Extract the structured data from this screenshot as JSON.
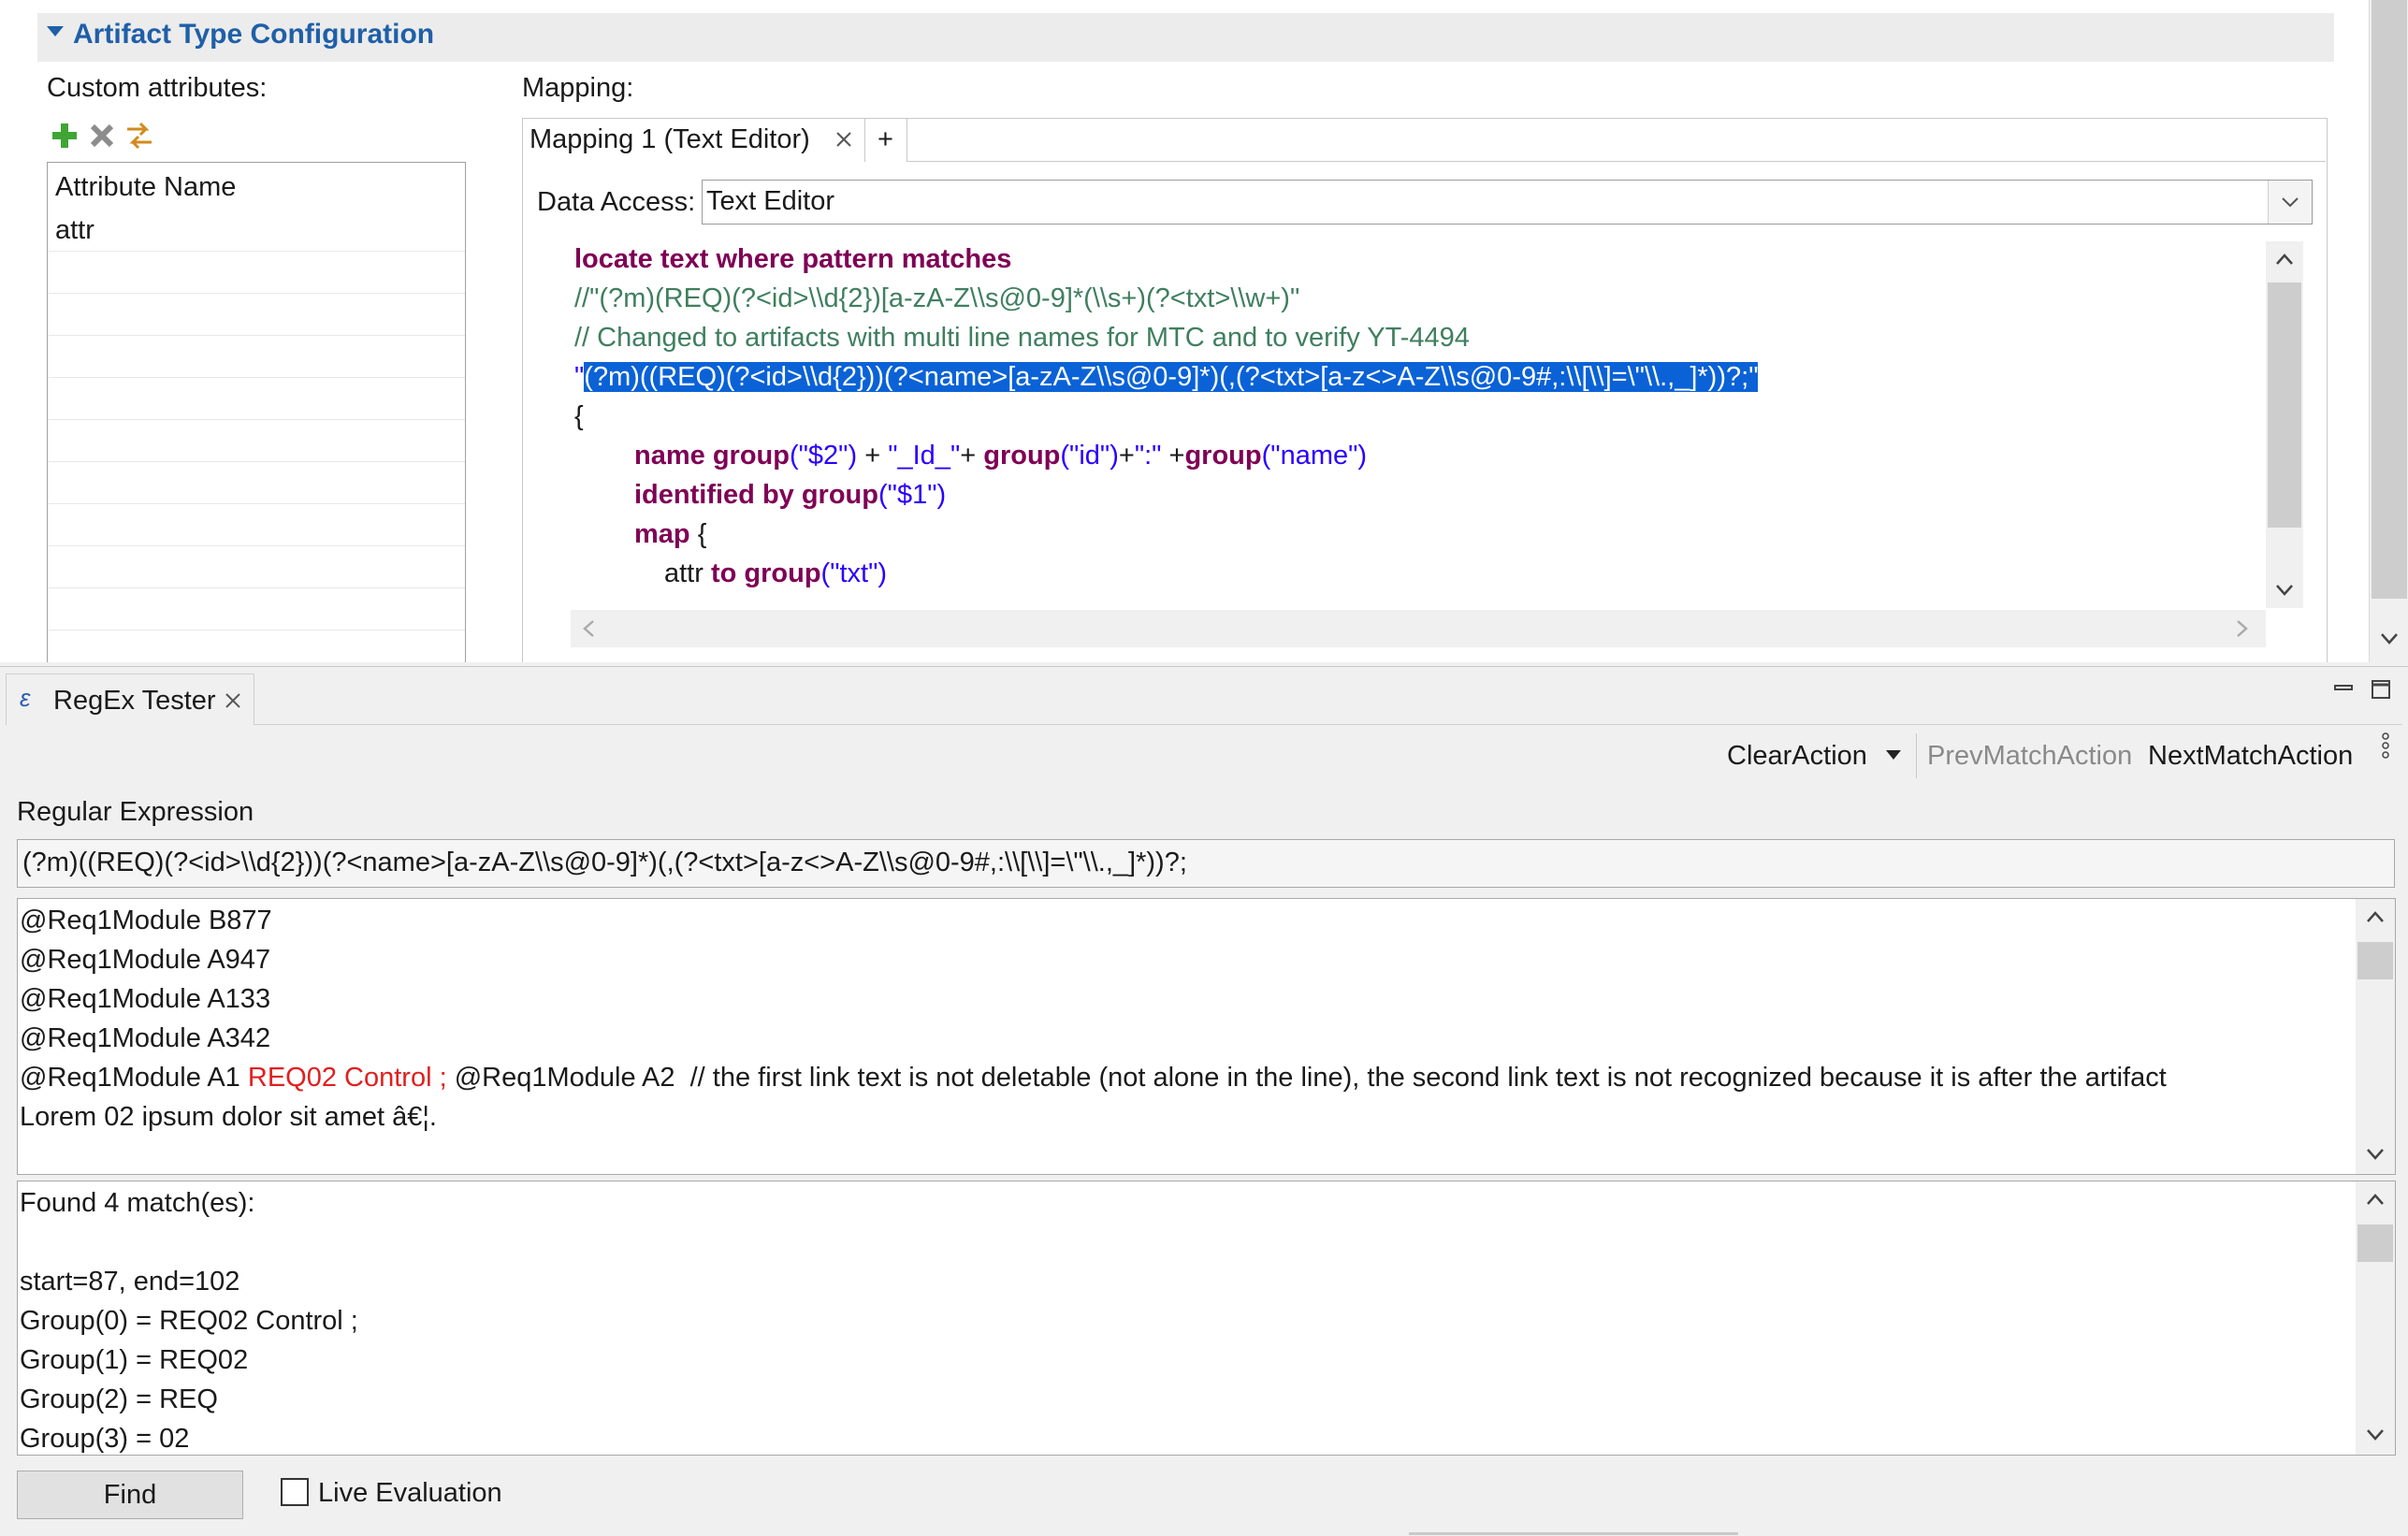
{
  "section": {
    "title": "Artifact Type Configuration"
  },
  "custom_attributes": {
    "label": "Custom attributes:",
    "table_header": "Attribute Name",
    "rows": [
      "attr"
    ]
  },
  "mapping": {
    "label": "Mapping:",
    "tab_label": "Mapping 1 (Text Editor)",
    "add_tab": "+",
    "data_access_label": "Data Access:",
    "data_access_value": "Text Editor",
    "code": {
      "l1": "locate text where pattern matches",
      "l2": "//\"(?m)(REQ)(?<id>\\\\d{2})[a-zA-Z\\\\s@0-9]*(\\\\s+)(?<txt>\\\\w+)\"",
      "l3": "// Changed to artifacts with multi line names for MTC and to verify YT-4494",
      "l4_q1": "\"",
      "l4_sel": "(?m)((REQ)(?<id>\\\\d{2}))(?<name>[a-zA-Z\\\\s@0-9]*)(,(?<txt>[a-z<>A-Z\\\\s@0-9#,:\\\\[\\\\]=\\\"\\\\.,_]*))?;",
      "l4_q2": "\"",
      "l5": "{",
      "l6_kw1": "name group",
      "l6_s1": "(\"$2\")",
      "l6_p1": " + ",
      "l6_s2": "\"_Id_\"",
      "l6_p2": "+ ",
      "l6_kw2": "group",
      "l6_s3": "(\"id\")",
      "l6_p3": "+",
      "l6_s4": "\":\"",
      "l6_p4": " +",
      "l6_kw3": "group",
      "l6_s5": "(\"name\")",
      "l7_kw": "identified by group",
      "l7_s": "(\"$1\")",
      "l8_kw": "map",
      "l8_p": " {",
      "l9_p": "attr ",
      "l9_kw": "to group",
      "l9_s": "(\"txt\")"
    }
  },
  "regex_tester": {
    "tab_label": "RegEx Tester",
    "tab_icon": "ε",
    "toolbar": {
      "clear": "ClearAction",
      "prev": "PrevMatchAction",
      "next": "NextMatchAction"
    },
    "regex_label": "Regular Expression",
    "regex_value": "(?m)((REQ)(?<id>\\\\d{2}))(?<name>[a-zA-Z\\\\s@0-9]*)(,(?<txt>[a-z<>A-Z\\\\s@0-9#,:\\\\[\\\\]=\\\"\\\\.,_]*))?;",
    "sample": {
      "l1": "@Req1Module B877",
      "l2": "@Req1Module A947",
      "l3": "@Req1Module A133",
      "l4": "@Req1Module A342",
      "l5a": "@Req1Module A1 ",
      "l5b": "REQ02 Control ;",
      "l5c": " @Req1Module A2  // the first link text is not deletable (not alone in the line), the second link text is not recognized because it is after the artifact",
      "l6": "Lorem 02 ipsum dolor sit amet â€¦."
    },
    "results": [
      "Found 4 match(es):",
      "",
      "start=87, end=102",
      "Group(0) = REQ02 Control ;",
      "Group(1) = REQ02",
      "Group(2) = REQ",
      "Group(3) = 02"
    ],
    "find_button": "Find",
    "live_evaluation": "Live Evaluation"
  },
  "colors": {
    "keyword": "#7f0055",
    "comment": "#3f7f5f",
    "string": "#2a00ff",
    "selection": "#0a62d6",
    "section_title": "#1f5fa8",
    "match_highlight": "#e02020"
  }
}
